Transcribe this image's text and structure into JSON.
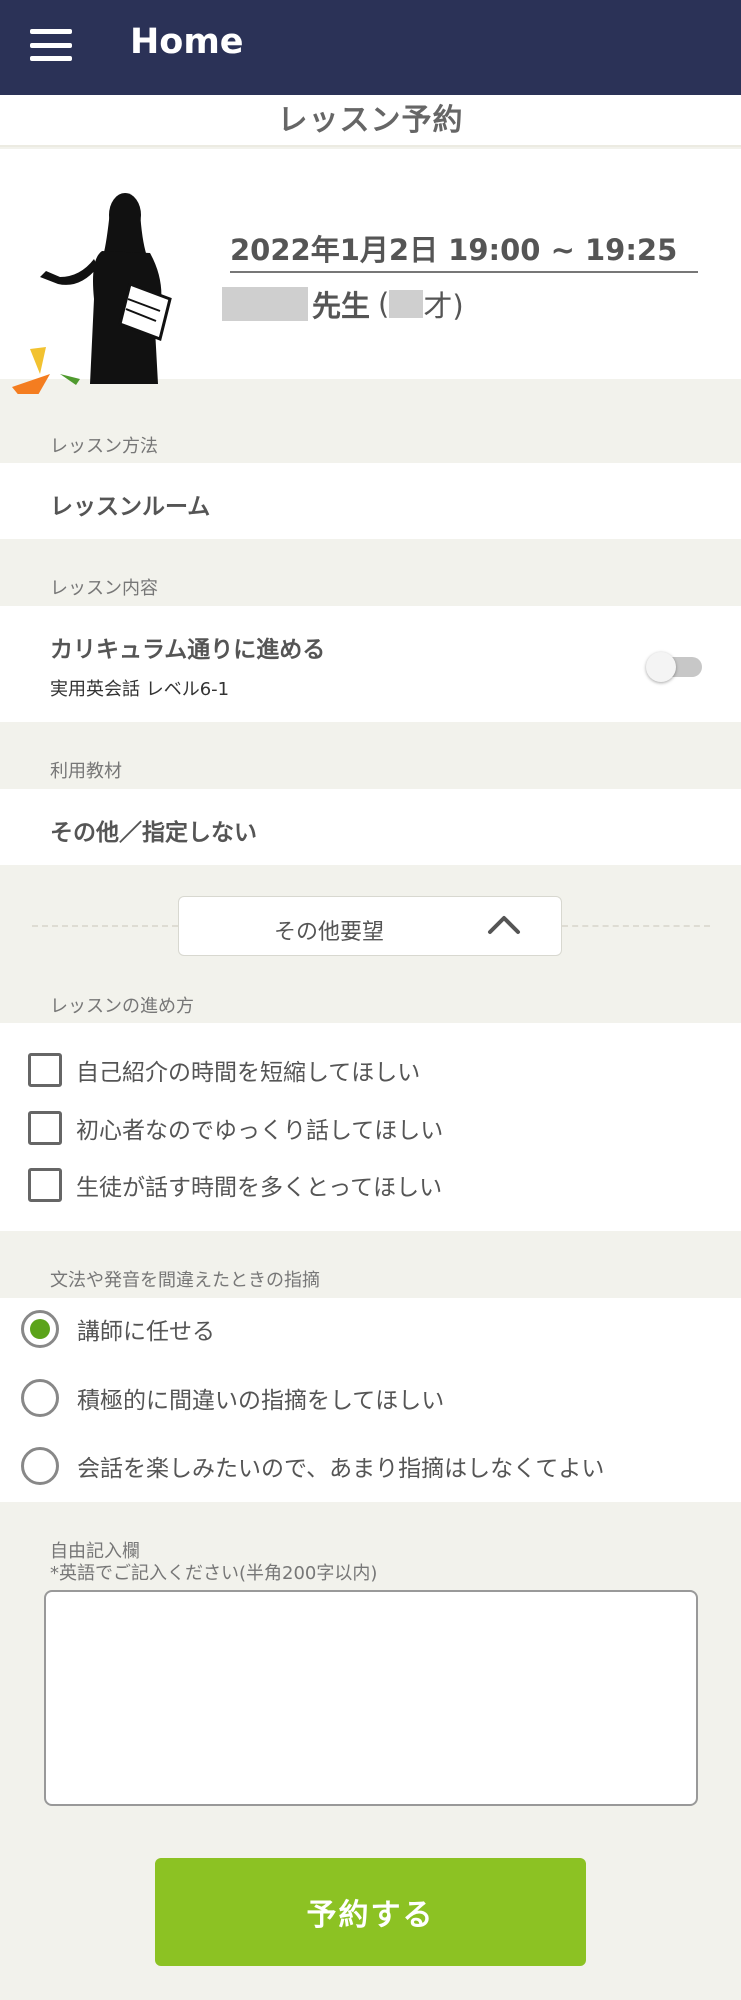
{
  "appbar": {
    "title": "Home",
    "bg_color": "#2b3257",
    "menu_icon": "hamburger-menu-icon"
  },
  "page": {
    "title": "レッスン予約"
  },
  "teacher": {
    "datetime": "2022年1月2日 19:00 ~ 19:25",
    "suffix": "先生",
    "age_open": "(",
    "age_close": "才)"
  },
  "method": {
    "label": "レッスン方法",
    "value": "レッスンルーム"
  },
  "content": {
    "label": "レッスン内容",
    "value": "カリキュラム通りに進める",
    "sub": "実用英会話 レベル6-1",
    "toggle_on": false
  },
  "material": {
    "label": "利用教材",
    "value": "その他／指定しない"
  },
  "expand": {
    "label": "その他要望",
    "icon": "chevron-up-icon"
  },
  "progress": {
    "label": "レッスンの進め方",
    "options": [
      {
        "label": "自己紹介の時間を短縮してほしい",
        "checked": false
      },
      {
        "label": "初心者なのでゆっくり話してほしい",
        "checked": false
      },
      {
        "label": "生徒が話す時間を多くとってほしい",
        "checked": false
      }
    ]
  },
  "correction": {
    "label": "文法や発音を間違えたときの指摘",
    "options": [
      {
        "label": "講師に任せる",
        "selected": true
      },
      {
        "label": "積極的に間違いの指摘をしてほしい",
        "selected": false
      },
      {
        "label": "会話を楽しみたいので、あまり指摘はしなくてよい",
        "selected": false
      }
    ]
  },
  "free": {
    "label": "自由記入欄",
    "note": "*英語でご記入ください(半角200字以内)",
    "value": ""
  },
  "submit": {
    "label": "予約する",
    "color": "#8cc223"
  }
}
